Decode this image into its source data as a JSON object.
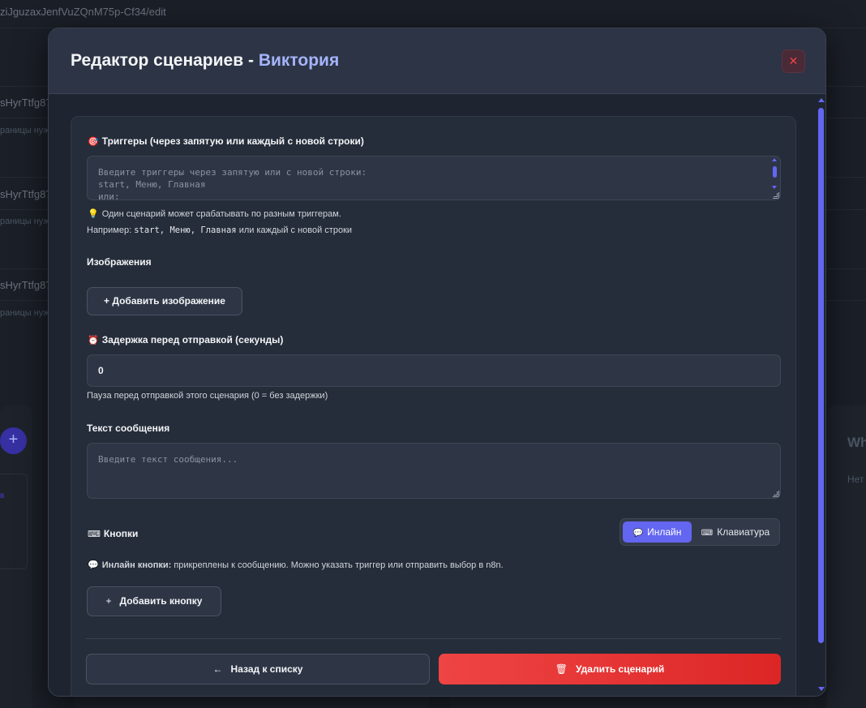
{
  "background": {
    "url_fragment": "ziJguzaxJenfVuZQnM75p-Cf34/edit",
    "list_ids": [
      "sHyrTtfg87",
      "sHyrTtfg87",
      "sHyrTtfg87"
    ],
    "list_subtitles": [
      "раницы нуж",
      "раницы нуж",
      "раницы нуж"
    ],
    "add_symbol": "+",
    "right_card_title": "Wh",
    "right_card_text": "Нет",
    "left_card_text": "в"
  },
  "modal": {
    "title": "Редактор сценариев",
    "title_separator": " - ",
    "bot_name": "Виктория",
    "close_symbol": "✕"
  },
  "triggers": {
    "icon": "target-icon",
    "icon_glyph": "🎯",
    "label": "Триггеры (через запятую или каждый с новой строки)",
    "placeholder": "Введите триггеры через запятую или с новой строки:\nstart, Меню, Главная\nили:",
    "hint_icon": "lightbulb-icon",
    "hint_icon_glyph": "💡",
    "hint_1": "Один сценарий может срабатывать по разным триггерам.",
    "hint_2_prefix": "Например: ",
    "hint_2_code": "start, Меню, Главная",
    "hint_2_suffix": " или каждый с новой строки"
  },
  "images": {
    "label": "Изображения",
    "add_button": "+ Добавить изображение"
  },
  "delay": {
    "icon": "alarm-clock-icon",
    "icon_glyph": "⏰",
    "label": "Задержка перед отправкой (секунды)",
    "value": "0",
    "hint": "Пауза перед отправкой этого сценария (0 = без задержки)"
  },
  "message": {
    "label": "Текст сообщения",
    "placeholder": "Введите текст сообщения..."
  },
  "buttons": {
    "icon": "keyboard-icon",
    "icon_glyph": "⌨",
    "label": "Кнопки",
    "mode_inline_icon_glyph": "💬",
    "mode_inline": "Инлайн",
    "mode_keyboard_icon_glyph": "⌨",
    "mode_keyboard": "Клавиатура",
    "selected_mode": "Инлайн",
    "info_icon_glyph": "💬",
    "info_bold": "Инлайн кнопки:",
    "info_text": " прикреплены к сообщению. Можно указать триггер или отправить выбор в n8n.",
    "add_icon_glyph": "+",
    "add_button": "Добавить кнопку"
  },
  "footer": {
    "back_icon_glyph": "←",
    "back_button": "Назад к списку",
    "delete_icon_glyph": "🗑",
    "delete_button": "Удалить сценарий"
  },
  "colors": {
    "accent": "#6366f1",
    "title_accent": "#a5b4fc",
    "danger": "#ef4444"
  }
}
